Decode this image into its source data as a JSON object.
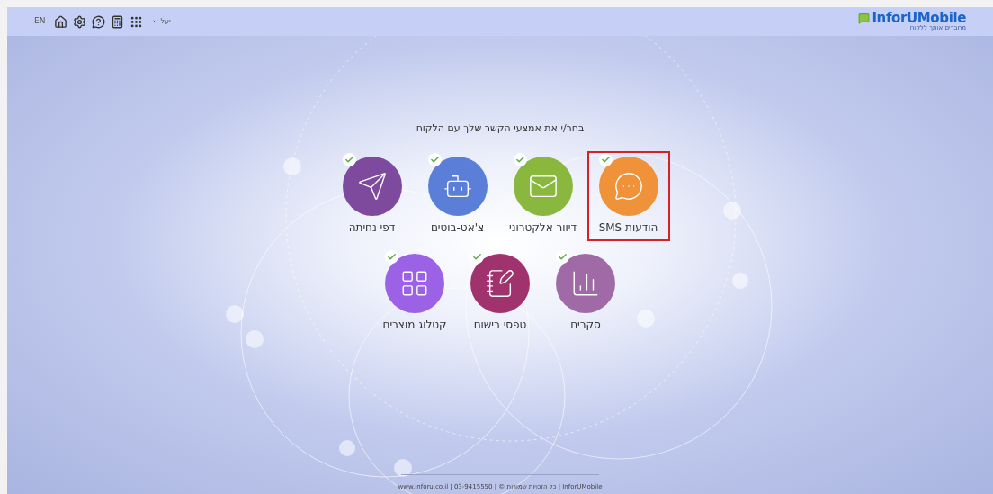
{
  "header": {
    "language": "EN",
    "user": "יעל",
    "logo": {
      "name": "InforUMobile",
      "tagline": "מחברים אותך ללקוח"
    }
  },
  "prompt": "בחר/י את אמצעי הקשר שלך עם הלקוח",
  "channel_rows": [
    [
      {
        "kind": "sms",
        "label": "הודעות SMS",
        "color": "#f0923a",
        "checked": true,
        "selected": true
      },
      {
        "kind": "email",
        "label": "דיוור אלקטרוני",
        "color": "#8ab83e",
        "checked": true,
        "selected": false
      },
      {
        "kind": "bot",
        "label": "צ'אט-בוטים",
        "color": "#5b7fd8",
        "checked": true,
        "selected": false
      },
      {
        "kind": "landing",
        "label": "דפי נחיתה",
        "color": "#7d4a9e",
        "checked": true,
        "selected": false
      }
    ],
    [
      {
        "kind": "survey",
        "label": "סקרים",
        "color": "#a06aa6",
        "checked": true,
        "selected": false
      },
      {
        "kind": "form",
        "label": "טפסי רישום",
        "color": "#a0336e",
        "checked": true,
        "selected": false
      },
      {
        "kind": "catalog",
        "label": "קטלוג מוצרים",
        "color": "#9b62e6",
        "checked": true,
        "selected": false
      }
    ]
  ],
  "footer": "www.inforu.co.il | 03-9415550 | © כל הזכויות שמורות | InforUMobile"
}
